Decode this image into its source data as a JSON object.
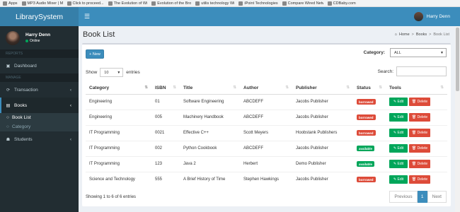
{
  "bookmarks": [
    "Apps",
    "MP3 Audio Mixer | M",
    "Click to proceed...",
    "The Evolution of Wi",
    "Evolution of the Bro",
    "utilis technology Wi",
    "iPoint Technologies",
    "Compare Wired Netw",
    "CDBaby.com"
  ],
  "brand": "LibrarySystem",
  "header": {
    "menu_icon": "☰",
    "user_name": "Harry Denn"
  },
  "sidebar": {
    "user": {
      "name": "Harry Denn",
      "status": "Online"
    },
    "section_reports": "REPORTS",
    "dashboard": "Dashboard",
    "section_manage": "MANAGE",
    "transaction": "Transaction",
    "books": "Books",
    "book_list": "Book List",
    "category": "Category",
    "students": "Students"
  },
  "page": {
    "title": "Book List"
  },
  "breadcrumb": {
    "home": "Home",
    "sep": ">",
    "books": "Books",
    "current": "Book List"
  },
  "toolbar": {
    "new_label": "+ New",
    "category_label": "Category:",
    "category_value": "ALL"
  },
  "length": {
    "show": "Show",
    "value": "10",
    "entries": "entries"
  },
  "search": {
    "label": "Search:"
  },
  "table": {
    "headers": [
      "Category",
      "ISBN",
      "Title",
      "Author",
      "Publisher",
      "Status",
      "Tools"
    ],
    "rows": [
      {
        "category": "Engineering",
        "isbn": "01",
        "title": "Software Engineering",
        "author": "ABCDEFF",
        "publisher": "Jacobs Publisher",
        "status": "borrowed"
      },
      {
        "category": "Engineering",
        "isbn": "005",
        "title": "Machinery Handbook",
        "author": "ABCDEFF",
        "publisher": "Jacobs Publisher",
        "status": "borrowed"
      },
      {
        "category": "IT Programming",
        "isbn": "0021",
        "title": "Effective C++",
        "author": "Scott Meyers",
        "publisher": "Hoobstank Publishers",
        "status": "borrowed"
      },
      {
        "category": "IT Programming",
        "isbn": "002",
        "title": "Python Cookbook",
        "author": "ABCDEFF",
        "publisher": "Jacobs Publisher",
        "status": "available"
      },
      {
        "category": "IT Programming",
        "isbn": "123",
        "title": "Java 2",
        "author": "Herbert",
        "publisher": "Demo Publisher",
        "status": "available"
      },
      {
        "category": "Science and Technology",
        "isbn": "555",
        "title": "A Brief History of Time",
        "author": "Stephen Hawkings",
        "publisher": "Jacobs Publisher",
        "status": "borrowed"
      }
    ],
    "edit_label": "Edit",
    "delete_label": "Delete"
  },
  "footer": {
    "info": "Showing 1 to 6 of 6 entries",
    "prev": "Previous",
    "page": "1",
    "next": "Next"
  },
  "colors": {
    "navbar": "#3c8dbc",
    "sidebar": "#222d32",
    "borrowed": "#dd4b39",
    "available": "#00a65a"
  }
}
